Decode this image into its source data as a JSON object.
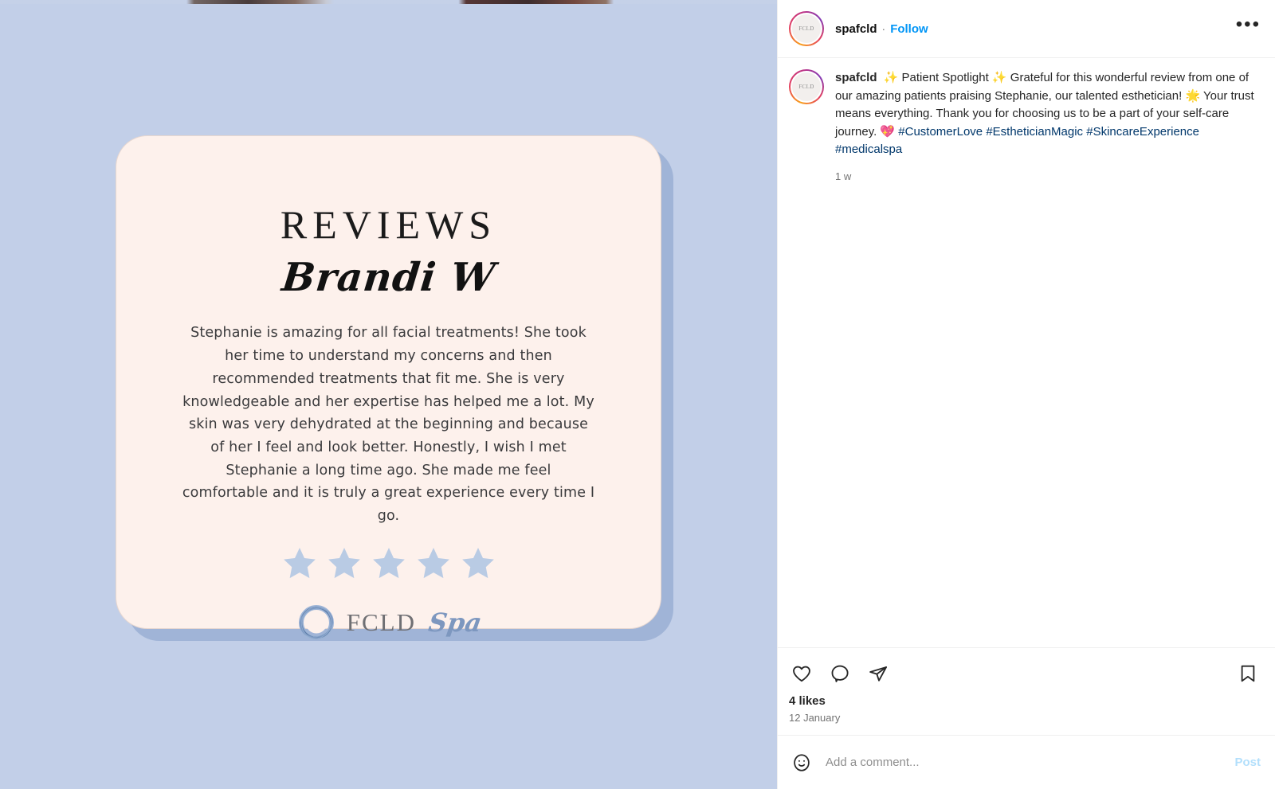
{
  "colors": {
    "media_background": "#c2cfe8",
    "card_background": "#fdf1ec",
    "card_shadow": "#9aafd4",
    "star": "#b9cbe4",
    "follow_blue": "#0095f6",
    "hashtag_blue": "#00376b",
    "post_disabled": "#b2dffc",
    "logo_script": "#7d97bf",
    "logo_text": "#6f6f73"
  },
  "header": {
    "username": "spafcld",
    "separator": "·",
    "follow_label": "Follow",
    "more_label": "•••",
    "avatar_text": "FCLD"
  },
  "caption": {
    "username": "spafcld",
    "segments": [
      {
        "type": "text",
        "value": " ✨ Patient Spotlight ✨ Grateful for this wonderful review from one of our amazing patients praising Stephanie, our talented esthetician! 🌟 Your trust means everything. Thank you for choosing us to be a part of your self-care journey. 💖 "
      },
      {
        "type": "hashtag",
        "value": "#CustomerLove"
      },
      {
        "type": "text",
        "value": " "
      },
      {
        "type": "hashtag",
        "value": "#EstheticianMagic"
      },
      {
        "type": "text",
        "value": " "
      },
      {
        "type": "hashtag",
        "value": "#SkincareExperience"
      },
      {
        "type": "text",
        "value": " "
      },
      {
        "type": "hashtag",
        "value": "#medicalspa"
      }
    ],
    "timestamp": "1 w"
  },
  "actions": {
    "like_label": "Like",
    "comment_label": "Comment",
    "share_label": "Share",
    "save_label": "Save"
  },
  "engagement": {
    "likes": "4 likes",
    "date": "12 January"
  },
  "comment_bar": {
    "placeholder": "Add a comment...",
    "post_label": "Post",
    "value": ""
  },
  "review_card": {
    "title": "REVIEWS",
    "reviewer_name": "Brandi W",
    "body": "Stephanie is amazing for all facial treatments! She took her time to understand my concerns and then recommended treatments that fit me. She is very knowledgeable and her expertise has helped me a lot. My skin was very dehydrated at the beginning and because of her I feel and look better. Honestly, I wish I met Stephanie a long time ago. She made me feel comfortable and it is truly a great experience every time I go.",
    "rating": 5,
    "rating_max": 5,
    "brand_name": "FCLD",
    "brand_suffix": "Spa"
  }
}
